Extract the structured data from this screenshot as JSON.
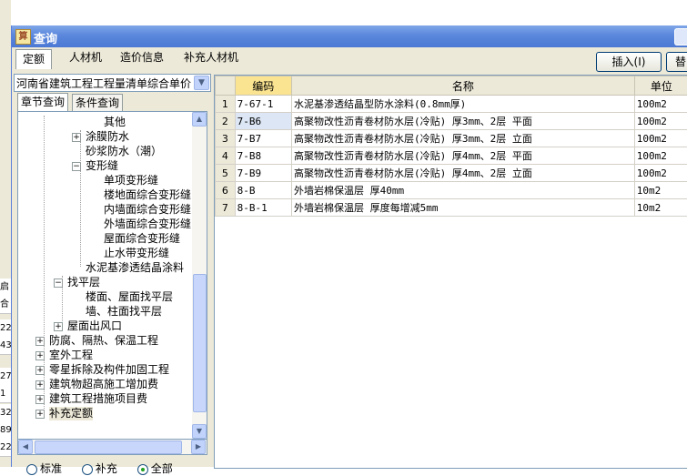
{
  "window": {
    "title": "查询"
  },
  "main_tabs": [
    "定额",
    "人材机",
    "造价信息",
    "补充人材机"
  ],
  "buttons": {
    "insert": "插入(I)",
    "replace": "替"
  },
  "combo": {
    "value": "河南省建筑工程工程量清单综合单价"
  },
  "sub_tabs": [
    "章节查询",
    "条件查询"
  ],
  "tree": [
    {
      "label": "其他",
      "level": 4,
      "toggle": ""
    },
    {
      "label": "涂膜防水",
      "level": 3,
      "toggle": "+"
    },
    {
      "label": "砂浆防水（潮）",
      "level": 3,
      "toggle": ""
    },
    {
      "label": "变形缝",
      "level": 3,
      "toggle": "-"
    },
    {
      "label": "单项变形缝",
      "level": 4,
      "toggle": ""
    },
    {
      "label": "楼地面综合变形缝",
      "level": 4,
      "toggle": ""
    },
    {
      "label": "内墙面综合变形缝",
      "level": 4,
      "toggle": ""
    },
    {
      "label": "外墙面综合变形缝",
      "level": 4,
      "toggle": ""
    },
    {
      "label": "屋面综合变形缝",
      "level": 4,
      "toggle": ""
    },
    {
      "label": "止水带变形缝",
      "level": 4,
      "toggle": ""
    },
    {
      "label": "水泥基渗透结晶涂料",
      "level": 3,
      "toggle": ""
    },
    {
      "label": "找平层",
      "level": 2,
      "toggle": "-"
    },
    {
      "label": "楼面、屋面找平层",
      "level": 3,
      "toggle": ""
    },
    {
      "label": "墙、柱面找平层",
      "level": 3,
      "toggle": ""
    },
    {
      "label": "屋面出风口",
      "level": 2,
      "toggle": "+"
    },
    {
      "label": "防腐、隔热、保温工程",
      "level": 1,
      "toggle": "+"
    },
    {
      "label": "室外工程",
      "level": 1,
      "toggle": "+"
    },
    {
      "label": "零星拆除及构件加固工程",
      "level": 1,
      "toggle": "+"
    },
    {
      "label": "建筑物超高施工增加费",
      "level": 1,
      "toggle": "+"
    },
    {
      "label": "建筑工程措施项目费",
      "level": 1,
      "toggle": "+"
    },
    {
      "label": "补充定额",
      "level": 1,
      "toggle": "+"
    }
  ],
  "radios": [
    {
      "label": "标准",
      "checked": false
    },
    {
      "label": "补充",
      "checked": false
    },
    {
      "label": "全部",
      "checked": true
    }
  ],
  "grid": {
    "headers": {
      "code": "编码",
      "name": "名称",
      "unit": "单位"
    },
    "rows": [
      {
        "no": "1",
        "code": "7-67-1",
        "name": "水泥基渗透结晶型防水涂料(0.8mm厚)",
        "unit": "100m2"
      },
      {
        "no": "2",
        "code": "7-B6",
        "name": "高聚物改性沥青卷材防水层(冷贴) 厚3mm、2层 平面",
        "unit": "100m2"
      },
      {
        "no": "3",
        "code": "7-B7",
        "name": "高聚物改性沥青卷材防水层(冷贴) 厚3mm、2层 立面",
        "unit": "100m2"
      },
      {
        "no": "4",
        "code": "7-B8",
        "name": "高聚物改性沥青卷材防水层(冷贴) 厚4mm、2层 平面",
        "unit": "100m2"
      },
      {
        "no": "5",
        "code": "7-B9",
        "name": "高聚物改性沥青卷材防水层(冷贴) 厚4mm、2层 立面",
        "unit": "100m2"
      },
      {
        "no": "6",
        "code": "8-B",
        "name": "外墙岩棉保温层 厚40mm",
        "unit": "10m2"
      },
      {
        "no": "7",
        "code": "8-B-1",
        "name": "外墙岩棉保温层 厚度每增减5mm",
        "unit": "10m2"
      }
    ]
  },
  "background_rows": [
    "启",
    "合",
    "22",
    "43",
    "27",
    "1",
    "32",
    "89",
    "22"
  ]
}
